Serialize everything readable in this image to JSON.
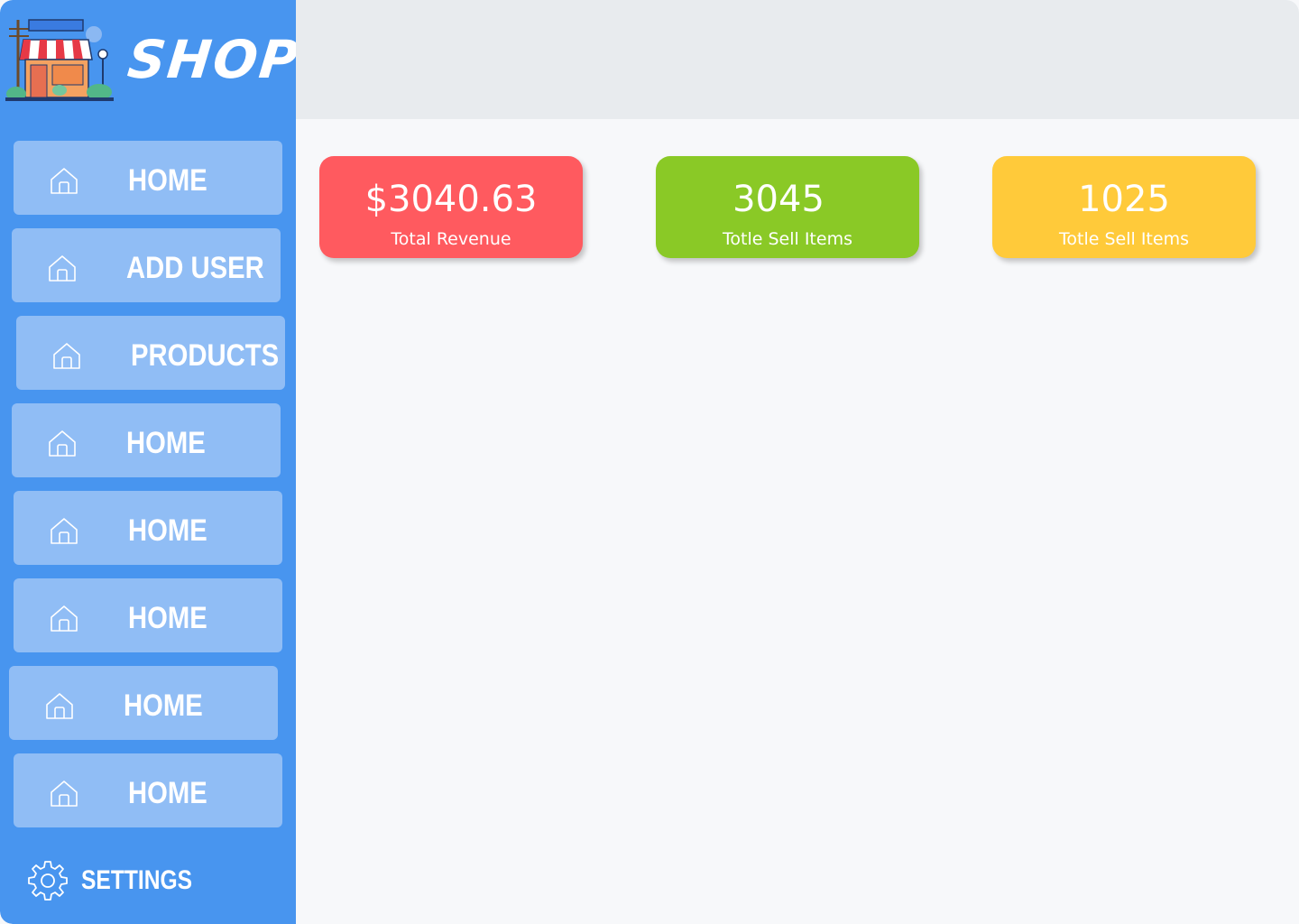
{
  "brand": {
    "name": "SHOP"
  },
  "colors": {
    "sidebar": "#4895ef",
    "nav_item": "#90bdf5",
    "topbar": "#e8ebee",
    "main_bg": "#f7f8fa",
    "revenue_card": "#ff5a5f",
    "sell_items_card": "#8ac926",
    "sell_items_card_2": "#ffca3a"
  },
  "sidebar": {
    "items": [
      {
        "label": "HOME",
        "icon": "home-icon"
      },
      {
        "label": "ADD USER",
        "icon": "home-icon"
      },
      {
        "label": "PRODUCTS",
        "icon": "home-icon"
      },
      {
        "label": "HOME",
        "icon": "home-icon"
      },
      {
        "label": "HOME",
        "icon": "home-icon"
      },
      {
        "label": "HOME",
        "icon": "home-icon"
      },
      {
        "label": "HOME",
        "icon": "home-icon"
      },
      {
        "label": "HOME",
        "icon": "home-icon"
      }
    ],
    "settings": {
      "label": "SETTINGS",
      "icon": "gear-icon"
    }
  },
  "stats": [
    {
      "value": "$3040.63",
      "caption": "Total Revenue"
    },
    {
      "value": "3045",
      "caption": "Totle Sell Items"
    },
    {
      "value": "1025",
      "caption": "Totle Sell Items"
    }
  ]
}
